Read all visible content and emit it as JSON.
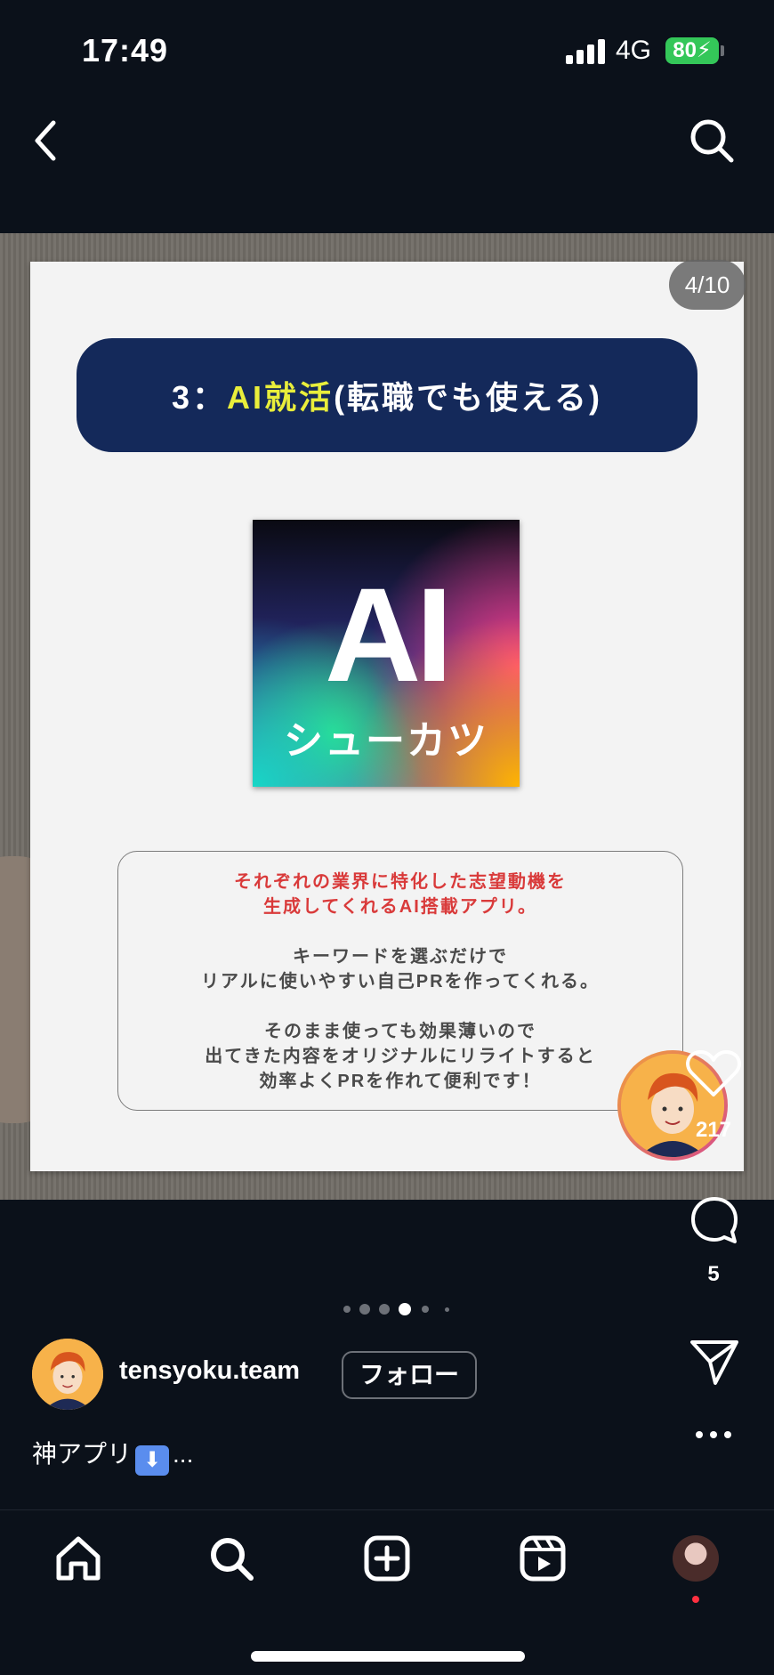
{
  "status": {
    "time": "17:49",
    "network": "4G",
    "battery": "80"
  },
  "post": {
    "page_counter": "4/10",
    "slide": {
      "title_prefix": "3：",
      "title_accent": "AI就活",
      "title_suffix": "(転職でも使える)",
      "app_icon_big": "AI",
      "app_icon_sub": "シューカツ",
      "desc_red_line1": "それぞれの業界に特化した志望動機を",
      "desc_red_line2": "生成してくれるAI搭載アプリ。",
      "desc_line3": "キーワードを選ぶだけで",
      "desc_line4": "リアルに使いやすい自己PRを作ってくれる。",
      "desc_line5": "そのまま使っても効果薄いので",
      "desc_line6": "出てきた内容をオリジナルにリライトすると",
      "desc_line7": "効率よくPRを作れて便利です！"
    },
    "likes": "217",
    "comments": "5",
    "username": "tensyoku.team",
    "follow_label": "フォロー",
    "caption_text": "神アプリ",
    "caption_more": "...",
    "carousel_dots": {
      "count": 6,
      "active_index": 3
    }
  },
  "icons": {
    "back": "chevron-left-icon",
    "search": "search-icon",
    "like": "heart-icon",
    "comment": "comment-bubble-icon",
    "share": "paper-plane-icon",
    "more": "more-dots-icon",
    "caption_emoji": "down-arrow-emoji"
  },
  "bottom_nav": [
    "home-icon",
    "search-icon",
    "create-icon",
    "reels-icon",
    "profile"
  ],
  "colors": {
    "accent_yellow": "#e9ee3b",
    "title_navy": "#14295a",
    "desc_red": "#d93a3a",
    "battery_green": "#34c759",
    "notification_red": "#ff3040"
  }
}
